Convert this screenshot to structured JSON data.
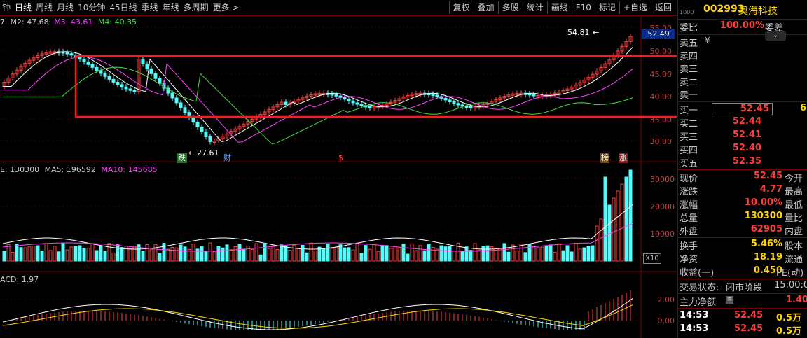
{
  "toolbar": {
    "periods": [
      "钟",
      "日线",
      "周线",
      "月线",
      "10分钟",
      "45日线",
      "季线",
      "年线",
      "多周期",
      "更多 >"
    ],
    "active_index": 1,
    "buttons": [
      "复权",
      "叠加",
      "多股",
      "统计",
      "画线",
      "F10",
      "标记",
      "+自选",
      "返回"
    ]
  },
  "legend": {
    "price": [
      "7",
      "M2: 47.68",
      "M3: 43.61",
      "M4: 40.35"
    ],
    "volume": [
      "E: 130300",
      "MA5: 196592",
      "MA10: 145685"
    ],
    "macd": [
      "ACD: 1.97"
    ]
  },
  "price_axis": [
    "55.00",
    "50.00",
    "45.00",
    "40.00",
    "35.00",
    "30.00"
  ],
  "volume_axis": [
    "30000",
    "20000",
    "10000",
    "X10"
  ],
  "macd_axis": [
    "2.00",
    "0.00"
  ],
  "annotations": {
    "high": "54.81",
    "low": "27.61",
    "current_price_tag": "52.49",
    "event_labels": [
      "跌",
      "财",
      "$",
      "榜",
      "涨"
    ]
  },
  "stock": {
    "code": "002993",
    "name": "奥海科技",
    "small_label": "1000"
  },
  "order_book": {
    "wei_bi_label": "委比",
    "wei_bi_value": "100.00%",
    "wei_cha_label": "委差",
    "sell": [
      {
        "label": "卖五",
        "price": "",
        "vol": ""
      },
      {
        "label": "卖四",
        "price": "",
        "vol": ""
      },
      {
        "label": "卖三",
        "price": "",
        "vol": ""
      },
      {
        "label": "卖二",
        "price": "",
        "vol": ""
      },
      {
        "label": "卖一",
        "price": "",
        "vol": ""
      }
    ],
    "buy": [
      {
        "label": "买一",
        "price": "52.45",
        "vol": "6"
      },
      {
        "label": "买二",
        "price": "52.44",
        "vol": ""
      },
      {
        "label": "买三",
        "price": "52.41",
        "vol": ""
      },
      {
        "label": "买四",
        "price": "52.40",
        "vol": ""
      },
      {
        "label": "买五",
        "price": "52.35",
        "vol": ""
      }
    ],
    "currency_mark": "¥"
  },
  "quote": [
    {
      "label": "现价",
      "value": "52.45",
      "label2": "今开",
      "color": "#ff3c3c"
    },
    {
      "label": "涨跌",
      "value": "4.77",
      "label2": "最高",
      "color": "#ff3c3c"
    },
    {
      "label": "涨幅",
      "value": "10.00%",
      "label2": "最低",
      "color": "#ff3c3c"
    },
    {
      "label": "总量",
      "value": "130300",
      "label2": "量比",
      "color": "#ffd700"
    },
    {
      "label": "外盘",
      "value": "62905",
      "label2": "内盘",
      "color": "#ff3c3c"
    }
  ],
  "quote2": [
    {
      "label": "换手",
      "value": "5.46%",
      "label2": "股本",
      "color": "#ffd700"
    },
    {
      "label": "净资",
      "value": "18.19",
      "label2": "流通",
      "color": "#ffd700"
    },
    {
      "label": "收益(一)",
      "value": "0.450",
      "label2": "PE(动)",
      "color": "#ffd700"
    }
  ],
  "status": {
    "trade_status_label": "交易状态:",
    "trade_status": "闭市阶段",
    "time": "15:00:0",
    "main_flow_label": "主力净额",
    "main_flow_value": "1.40"
  },
  "ticks": [
    {
      "time": "14:53",
      "price": "52.45",
      "vol": "0.5万"
    },
    {
      "time": "14:53",
      "price": "52.45",
      "vol": "0.5万"
    }
  ]
}
